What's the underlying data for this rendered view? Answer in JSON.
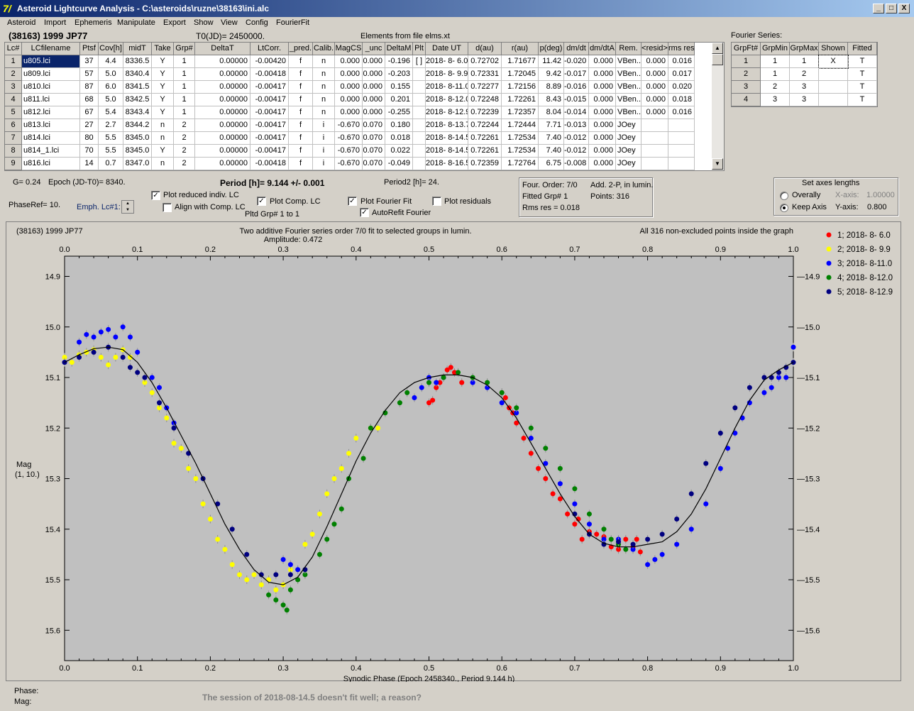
{
  "window": {
    "title": "Asteroid Lightcurve Analysis - C:\\asteroids\\ruzne\\38163\\ini.alc",
    "app_icon": "7/",
    "btn_min": "_",
    "btn_max": "□",
    "btn_close": "X"
  },
  "menu": [
    "Asteroid",
    "Import",
    "Ephemeris",
    "Manipulate",
    "Export",
    "Show",
    "View",
    "Config",
    "FourierFit"
  ],
  "header": {
    "asteroid": "(38163) 1999 JP77",
    "t0": "T0(JD)= 2450000.",
    "elements": "Elements from file elms.xt"
  },
  "lc_table": {
    "columns": [
      "Lc#",
      "LCfilename",
      "Ptsf",
      "Cov[h]",
      "midT",
      "Take",
      "Grp#",
      "DeltaT",
      "LtCorr.",
      "_pred.",
      "Calib.",
      "MagCS",
      "_unc",
      "DeltaM",
      "Plt",
      "Date UT",
      "d(au)",
      "r(au)",
      "p(deg)",
      "dm/dt",
      "dm/dtA",
      "Rem.",
      "<resid>",
      "rms res"
    ],
    "rows": [
      [
        "1",
        "u805.lci",
        "37",
        "4.4",
        "8336.5",
        "Y",
        "1",
        "0.00000",
        "-0.00420",
        "f",
        "n",
        "0.000",
        "0.000",
        "-0.196",
        "[ ]",
        "2018- 8- 6.0",
        "0.72702",
        "1.71677",
        "11.42",
        "-0.020",
        "0.000",
        "VBen..",
        "0.000",
        "0.016"
      ],
      [
        "2",
        "u809.lci",
        "57",
        "5.0",
        "8340.4",
        "Y",
        "1",
        "0.00000",
        "-0.00418",
        "f",
        "n",
        "0.000",
        "0.000",
        "-0.203",
        "",
        "2018- 8- 9.9",
        "0.72331",
        "1.72045",
        "9.42",
        "-0.017",
        "0.000",
        "VBen..",
        "0.000",
        "0.017"
      ],
      [
        "3",
        "u810.lci",
        "87",
        "6.0",
        "8341.5",
        "Y",
        "1",
        "0.00000",
        "-0.00417",
        "f",
        "n",
        "0.000",
        "0.000",
        "0.155",
        "",
        "2018- 8-11.0",
        "0.72277",
        "1.72156",
        "8.89",
        "-0.016",
        "0.000",
        "VBen..",
        "0.000",
        "0.020"
      ],
      [
        "4",
        "u811.lci",
        "68",
        "5.0",
        "8342.5",
        "Y",
        "1",
        "0.00000",
        "-0.00417",
        "f",
        "n",
        "0.000",
        "0.000",
        "0.201",
        "",
        "2018- 8-12.0",
        "0.72248",
        "1.72261",
        "8.43",
        "-0.015",
        "0.000",
        "VBen..",
        "0.000",
        "0.018"
      ],
      [
        "5",
        "u812.lci",
        "67",
        "5.4",
        "8343.4",
        "Y",
        "1",
        "0.00000",
        "-0.00417",
        "f",
        "n",
        "0.000",
        "0.000",
        "-0.255",
        "",
        "2018- 8-12.9",
        "0.72239",
        "1.72357",
        "8.04",
        "-0.014",
        "0.000",
        "VBen..",
        "0.000",
        "0.016"
      ],
      [
        "6",
        "u813.lci",
        "27",
        "2.7",
        "8344.2",
        "n",
        "2",
        "0.00000",
        "-0.00417",
        "f",
        "i",
        "-0.670",
        "0.070",
        "0.180",
        "",
        "2018- 8-13.7",
        "0.72244",
        "1.72444",
        "7.71",
        "-0.013",
        "0.000",
        "JOey",
        "",
        ""
      ],
      [
        "7",
        "u814.lci",
        "80",
        "5.5",
        "8345.0",
        "n",
        "2",
        "0.00000",
        "-0.00417",
        "f",
        "i",
        "-0.670",
        "0.070",
        "0.018",
        "",
        "2018- 8-14.5",
        "0.72261",
        "1.72534",
        "7.40",
        "-0.012",
        "0.000",
        "JOey",
        "",
        ""
      ],
      [
        "8",
        "u814_1.lci",
        "70",
        "5.5",
        "8345.0",
        "Y",
        "2",
        "0.00000",
        "-0.00417",
        "f",
        "i",
        "-0.670",
        "0.070",
        "0.022",
        "",
        "2018- 8-14.5",
        "0.72261",
        "1.72534",
        "7.40",
        "-0.012",
        "0.000",
        "JOey",
        "",
        ""
      ],
      [
        "9",
        "u816.lci",
        "14",
        "0.7",
        "8347.0",
        "n",
        "2",
        "0.00000",
        "-0.00418",
        "f",
        "i",
        "-0.670",
        "0.070",
        "-0.049",
        "",
        "2018- 8-16.5",
        "0.72359",
        "1.72764",
        "6.75",
        "-0.008",
        "0.000",
        "JOey",
        "",
        ""
      ]
    ]
  },
  "fourier_table": {
    "title": "Fourier Series:",
    "columns": [
      "GrpFt#",
      "GrpMin",
      "GrpMax",
      "Shown",
      "Fitted"
    ],
    "rows": [
      [
        "1",
        "1",
        "1",
        "X",
        "T"
      ],
      [
        "2",
        "1",
        "2",
        "",
        "T"
      ],
      [
        "3",
        "2",
        "3",
        "",
        "T"
      ],
      [
        "4",
        "3",
        "3",
        "",
        "T"
      ]
    ]
  },
  "controls": {
    "g": "G= 0.24",
    "epoch": "Epoch (JD-T0)= 8340.",
    "period": "Period [h]= 9.144 +/- 0.001",
    "period2": "Period2 [h]= 24.",
    "phaseref": "PhaseRef= 10.",
    "emph": "Emph. Lc#1:",
    "plot_reduced": "Plot reduced indiv. LC",
    "align_comp": "Align with Comp. LC",
    "plot_comp": "Plot Comp. LC",
    "pltd_grp": "Pltd Grp#  1   to   1",
    "plot_fourier": "Plot Fourier Fit",
    "autorefit": "AutoRefit Fourier",
    "plot_residuals": "Plot residuals",
    "four_order": "Four. Order:  7/0",
    "add_2p": "Add. 2-P, in lumin.",
    "fitted_grp": "Fitted Grp# 1",
    "points": "Points: 316",
    "rms_res": "Rms res     = 0.018",
    "axes_title": "Set axes lengths",
    "overally": "Overally",
    "keep_axis": "Keep Axis",
    "xaxis_label": "X-axis:",
    "xaxis_val": "1.00000",
    "yaxis_label": "Y-axis:",
    "yaxis_val": "0.800"
  },
  "checks": {
    "plot_reduced": true,
    "align_comp": false,
    "plot_comp": true,
    "plot_fourier": true,
    "autorefit": true,
    "plot_residuals": false
  },
  "status": {
    "phase": "Phase:",
    "mag": "Mag:",
    "message": "The session of 2018-08-14.5 doesn't fit well; a reason?"
  },
  "chart_data": {
    "type": "scatter",
    "title_left": "(38163) 1999 JP77",
    "title": "Two additive Fourier series order 7/0 fit to selected groups in lumin.",
    "subtitle": "Amplitude: 0.472",
    "title_right": "All 316 non-excluded points inside the graph",
    "xlabel": "Synodic Phase (Epoch 2458340., Period 9.144 h)",
    "ylabel": "Mag",
    "ylabel2": "(1, 10.)",
    "xlim": [
      0,
      1
    ],
    "ylim": [
      15.66,
      14.86
    ],
    "y_reversed": true,
    "xticks": [
      "0.0",
      "0.1",
      "0.2",
      "0.3",
      "0.4",
      "0.5",
      "0.6",
      "0.7",
      "0.8",
      "0.9",
      "1.0"
    ],
    "yticks": [
      "14.9",
      "15.0",
      "15.1",
      "15.2",
      "15.3",
      "15.4",
      "15.5",
      "15.6"
    ],
    "legend_position": "right",
    "fit_curve": {
      "name": "Fourier fit",
      "color": "#000000",
      "x": [
        0.0,
        0.02,
        0.04,
        0.06,
        0.08,
        0.1,
        0.12,
        0.14,
        0.16,
        0.18,
        0.2,
        0.22,
        0.24,
        0.26,
        0.28,
        0.3,
        0.32,
        0.34,
        0.36,
        0.38,
        0.4,
        0.42,
        0.44,
        0.46,
        0.48,
        0.5,
        0.52,
        0.54,
        0.56,
        0.58,
        0.6,
        0.62,
        0.64,
        0.66,
        0.68,
        0.7,
        0.72,
        0.74,
        0.76,
        0.78,
        0.8,
        0.82,
        0.84,
        0.86,
        0.88,
        0.9,
        0.92,
        0.94,
        0.96,
        0.98,
        1.0
      ],
      "y": [
        15.07,
        15.055,
        15.043,
        15.04,
        15.045,
        15.07,
        15.11,
        15.16,
        15.215,
        15.27,
        15.33,
        15.39,
        15.44,
        15.48,
        15.505,
        15.51,
        15.495,
        15.455,
        15.395,
        15.33,
        15.265,
        15.21,
        15.165,
        15.13,
        15.11,
        15.1,
        15.095,
        15.095,
        15.1,
        15.115,
        15.14,
        15.18,
        15.23,
        15.28,
        15.33,
        15.375,
        15.41,
        15.428,
        15.435,
        15.435,
        15.43,
        15.425,
        15.405,
        15.37,
        15.32,
        15.26,
        15.2,
        15.145,
        15.105,
        15.085,
        15.07
      ]
    },
    "series": [
      {
        "name": "1; 2018- 8- 6.0",
        "color": "#ff0000",
        "x": [
          0.5,
          0.505,
          0.51,
          0.515,
          0.52,
          0.525,
          0.53,
          0.535,
          0.545,
          0.6,
          0.605,
          0.61,
          0.615,
          0.62,
          0.63,
          0.64,
          0.65,
          0.66,
          0.67,
          0.68,
          0.69,
          0.7,
          0.705,
          0.71,
          0.72,
          0.73,
          0.74,
          0.75,
          0.76,
          0.77,
          0.78,
          0.785,
          0.79
        ],
        "y": [
          15.15,
          15.145,
          15.12,
          15.11,
          15.1,
          15.085,
          15.08,
          15.09,
          15.11,
          15.13,
          15.14,
          15.16,
          15.17,
          15.19,
          15.22,
          15.25,
          15.28,
          15.3,
          15.33,
          15.34,
          15.37,
          15.39,
          15.38,
          15.42,
          15.405,
          15.41,
          15.415,
          15.435,
          15.44,
          15.42,
          15.435,
          15.42,
          15.445
        ]
      },
      {
        "name": "2; 2018- 8- 9.9",
        "color": "#ffff00",
        "x": [
          0.0,
          0.01,
          0.02,
          0.03,
          0.04,
          0.05,
          0.06,
          0.07,
          0.08,
          0.09,
          0.11,
          0.12,
          0.13,
          0.14,
          0.15,
          0.16,
          0.17,
          0.18,
          0.19,
          0.2,
          0.21,
          0.22,
          0.23,
          0.24,
          0.25,
          0.26,
          0.27,
          0.28,
          0.29,
          0.3,
          0.31,
          0.33,
          0.34,
          0.35,
          0.36,
          0.37,
          0.38,
          0.39,
          0.4,
          0.42,
          0.43
        ],
        "y": [
          15.06,
          15.07,
          15.055,
          15.05,
          15.045,
          15.06,
          15.075,
          15.06,
          15.045,
          15.06,
          15.11,
          15.13,
          15.16,
          15.18,
          15.23,
          15.24,
          15.28,
          15.3,
          15.35,
          15.38,
          15.42,
          15.44,
          15.47,
          15.49,
          15.5,
          15.49,
          15.51,
          15.5,
          15.52,
          15.51,
          15.48,
          15.43,
          15.41,
          15.37,
          15.33,
          15.3,
          15.28,
          15.25,
          15.22,
          15.2,
          15.2
        ]
      },
      {
        "name": "3; 2018- 8-11.0",
        "color": "#0000ff",
        "x": [
          0.0,
          0.02,
          0.03,
          0.04,
          0.05,
          0.06,
          0.07,
          0.08,
          0.09,
          0.1,
          0.12,
          0.13,
          0.14,
          0.15,
          0.3,
          0.31,
          0.32,
          0.48,
          0.49,
          0.5,
          0.51,
          0.52,
          0.56,
          0.58,
          0.6,
          0.62,
          0.64,
          0.66,
          0.68,
          0.7,
          0.72,
          0.74,
          0.76,
          0.78,
          0.8,
          0.81,
          0.82,
          0.84,
          0.86,
          0.88,
          0.9,
          0.91,
          0.92,
          0.93,
          0.94,
          0.96,
          0.97,
          0.98,
          0.99,
          1.0
        ],
        "y": [
          15.07,
          15.03,
          15.015,
          15.02,
          15.01,
          15.005,
          15.02,
          15.0,
          15.02,
          15.05,
          15.1,
          15.12,
          15.16,
          15.19,
          15.46,
          15.47,
          15.48,
          15.14,
          15.12,
          15.1,
          15.11,
          15.1,
          15.11,
          15.12,
          15.15,
          15.17,
          15.22,
          15.27,
          15.31,
          15.35,
          15.39,
          15.42,
          15.42,
          15.44,
          15.47,
          15.46,
          15.45,
          15.43,
          15.4,
          15.35,
          15.28,
          15.24,
          15.21,
          15.18,
          15.15,
          15.13,
          15.12,
          15.1,
          15.1,
          15.04
        ]
      },
      {
        "name": "4; 2018- 8-12.0",
        "color": "#008000",
        "x": [
          0.28,
          0.29,
          0.3,
          0.305,
          0.31,
          0.32,
          0.33,
          0.35,
          0.36,
          0.37,
          0.38,
          0.39,
          0.41,
          0.42,
          0.44,
          0.46,
          0.47,
          0.5,
          0.52,
          0.54,
          0.56,
          0.58,
          0.6,
          0.62,
          0.64,
          0.66,
          0.68,
          0.7,
          0.72,
          0.74,
          0.75,
          0.76,
          0.77
        ],
        "y": [
          15.53,
          15.54,
          15.55,
          15.56,
          15.52,
          15.5,
          15.49,
          15.45,
          15.42,
          15.39,
          15.36,
          15.3,
          15.26,
          15.2,
          15.17,
          15.15,
          15.13,
          15.11,
          15.1,
          15.09,
          15.1,
          15.11,
          15.13,
          15.16,
          15.2,
          15.24,
          15.28,
          15.32,
          15.37,
          15.4,
          15.42,
          15.43,
          15.44
        ]
      },
      {
        "name": "5; 2018- 8-12.9",
        "color": "#000080",
        "x": [
          0.0,
          0.02,
          0.04,
          0.06,
          0.08,
          0.09,
          0.1,
          0.11,
          0.13,
          0.15,
          0.17,
          0.19,
          0.21,
          0.23,
          0.25,
          0.27,
          0.29,
          0.31,
          0.33,
          0.7,
          0.72,
          0.74,
          0.76,
          0.78,
          0.8,
          0.82,
          0.84,
          0.86,
          0.88,
          0.9,
          0.92,
          0.94,
          0.96,
          0.97,
          0.98,
          0.99,
          1.0
        ],
        "y": [
          15.07,
          15.06,
          15.05,
          15.04,
          15.06,
          15.08,
          15.09,
          15.1,
          15.15,
          15.2,
          15.25,
          15.3,
          15.35,
          15.4,
          15.45,
          15.49,
          15.49,
          15.49,
          15.48,
          15.37,
          15.41,
          15.43,
          15.425,
          15.43,
          15.42,
          15.41,
          15.38,
          15.33,
          15.27,
          15.21,
          15.16,
          15.12,
          15.1,
          15.1,
          15.09,
          15.08,
          15.07
        ]
      }
    ]
  }
}
